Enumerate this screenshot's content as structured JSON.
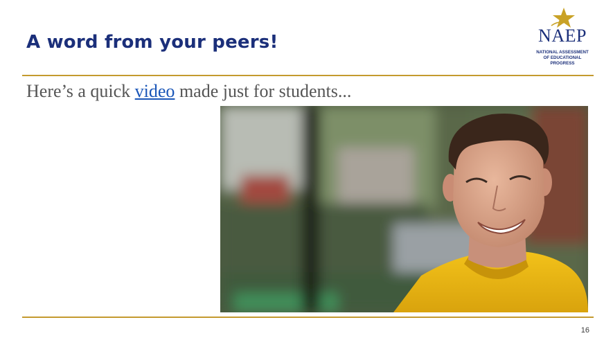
{
  "slide": {
    "title": "A word from your peers!",
    "subtitle_prefix": "Here’s a quick ",
    "subtitle_link": "video",
    "subtitle_suffix": " made just for students...",
    "page_number": "16"
  },
  "logo": {
    "mark": "NAEP",
    "line1": "NATIONAL ASSESSMENT",
    "line2": "OF EDUCATIONAL",
    "line3": "PROGRESS"
  },
  "colors": {
    "title": "#1b2f7a",
    "rule": "#c49a2e",
    "link": "#1a56b8",
    "star": "#c9a227"
  },
  "video": {
    "thumbnail": "smiling-student-in-yellow-shirt"
  }
}
